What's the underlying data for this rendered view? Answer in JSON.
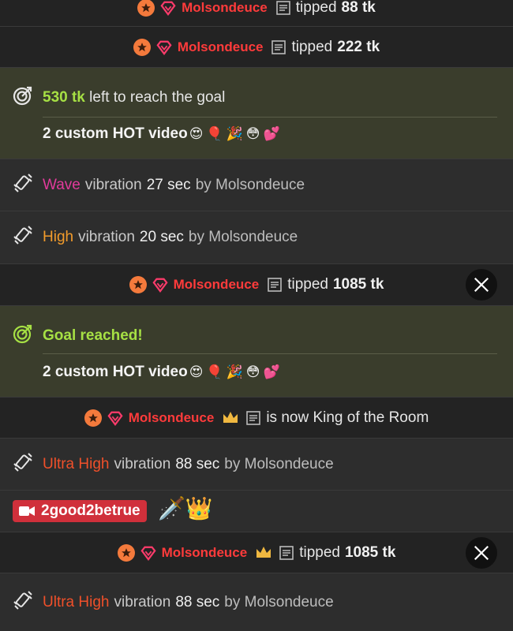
{
  "rows": {
    "r0": {
      "user": "Molsondeuce",
      "word": "tipped",
      "amount": "88 tk"
    },
    "r1": {
      "user": "Molsondeuce",
      "word": "tipped",
      "amount": "222 tk"
    },
    "goal1": {
      "highlight": "530 tk",
      "rest": "left to reach the goal",
      "title": "2 custom HOT video",
      "emojis": "😍🎈🎉😳💕"
    },
    "vib1": {
      "level": "Wave",
      "word": "vibration",
      "duration": "27 sec",
      "by": "by Molsondeuce"
    },
    "vib2": {
      "level": "High",
      "word": "vibration",
      "duration": "20 sec",
      "by": "by Molsondeuce"
    },
    "r2": {
      "user": "Molsondeuce",
      "word": "tipped",
      "amount": "1085 tk"
    },
    "goal2": {
      "highlight": "Goal reached!",
      "title": "2 custom HOT video",
      "emojis": "😍🎈🎉😳💕"
    },
    "king": {
      "user": "Molsondeuce",
      "text": "is now King of the Room"
    },
    "vib3": {
      "level": "Ultra High",
      "word": "vibration",
      "duration": "88 sec",
      "by": "by Molsondeuce"
    },
    "cam": {
      "name": "2good2betrue",
      "stickers": "🗡️👑"
    },
    "r3": {
      "user": "Molsondeuce",
      "word": "tipped",
      "amount": "1085 tk"
    },
    "vib4": {
      "level": "Ultra High",
      "word": "vibration",
      "duration": "88 sec",
      "by": "by Molsondeuce"
    }
  },
  "colors": {
    "user": "#ff3b3b",
    "lime": "#a6e044",
    "wave": "#e23a9b",
    "high": "#f29b2b",
    "ultra": "#f0502a",
    "goal_bg": "#3a3d2c"
  }
}
